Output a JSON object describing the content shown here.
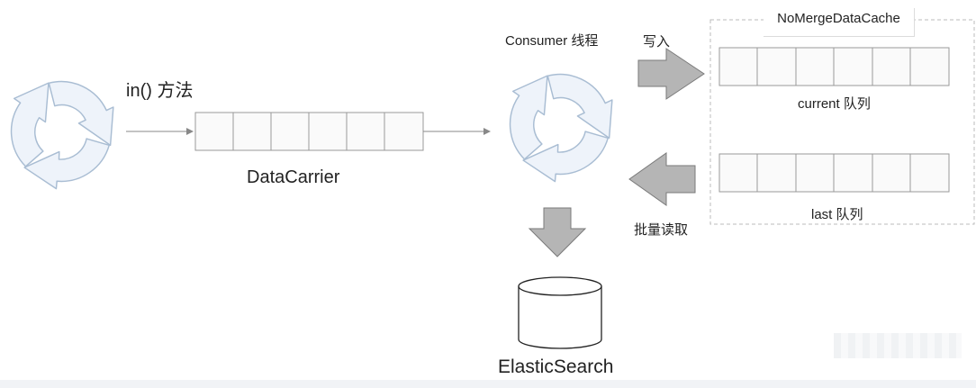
{
  "labels": {
    "in_method": "in() 方法",
    "data_carrier": "DataCarrier",
    "consumer_thread": "Consumer 线程",
    "write": "写入",
    "cache_title": "NoMergeDataCache",
    "current_queue": "current 队列",
    "last_queue": "last 队列",
    "batch_read": "批量读取",
    "elastic_search": "ElasticSearch"
  },
  "icons": {
    "cycle": "refresh-cycle-icon",
    "block_arrow": "block-arrow-icon",
    "database": "database-cylinder-icon"
  },
  "colors": {
    "cycle_fill": "#eef3fa",
    "cycle_stroke": "#a9bdd3",
    "queue_fill": "#fafafa",
    "queue_stroke": "#999999",
    "block_arrow_fill": "#b5b5b5",
    "block_arrow_stroke": "#7a7a7a",
    "connector": "#888888",
    "cache_border": "#bbbbbb"
  }
}
